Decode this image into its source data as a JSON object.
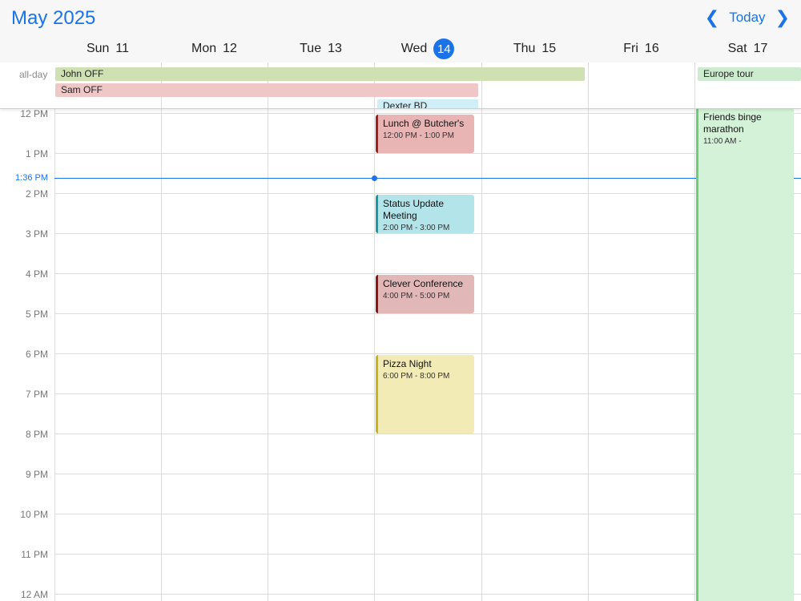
{
  "header": {
    "month_title": "May 2025",
    "today_label": "Today",
    "prev_icon": "chevron-left-icon",
    "next_icon": "chevron-right-icon"
  },
  "days": [
    {
      "name": "Sun",
      "num": "11"
    },
    {
      "name": "Mon",
      "num": "12"
    },
    {
      "name": "Tue",
      "num": "13"
    },
    {
      "name": "Wed",
      "num": "14"
    },
    {
      "name": "Thu",
      "num": "15"
    },
    {
      "name": "Fri",
      "num": "16"
    },
    {
      "name": "Sat",
      "num": "17"
    }
  ],
  "allday": {
    "label": "all-day",
    "events": [
      {
        "title": "John OFF",
        "color": "#cfe0b3"
      },
      {
        "title": "Sam OFF",
        "color": "#f0c7c7"
      },
      {
        "title": "Dexter BD",
        "color": "#cfeef6"
      },
      {
        "title": "Europe tour",
        "color": "#cdeccf"
      }
    ]
  },
  "hours": [
    "12 PM",
    "1 PM",
    "2 PM",
    "3 PM",
    "4 PM",
    "5 PM",
    "6 PM",
    "7 PM",
    "8 PM",
    "9 PM",
    "10 PM",
    "11 PM",
    "12 AM"
  ],
  "now_label": "1:36 PM",
  "events": [
    {
      "title": "Lunch @ Butcher's",
      "time": "12:00 PM - 1:00 PM",
      "bg": "#e8b4b4",
      "border": "#a51e1e"
    },
    {
      "title": "Status Update Meeting",
      "time": "2:00 PM - 3:00 PM",
      "bg": "#b2e4ea",
      "border": "#1a9aa6"
    },
    {
      "title": "Clever Conference",
      "time": "4:00 PM - 5:00 PM",
      "bg": "#e2b7b7",
      "border": "#8e1515"
    },
    {
      "title": "Pizza Night",
      "time": "6:00 PM - 8:00 PM",
      "bg": "#f2ebb6",
      "border": "#c8b418"
    },
    {
      "title": "Friends binge marathon",
      "time": "11:00 AM -",
      "bg": "#d3f2d7",
      "border": "#6ccf74"
    }
  ]
}
